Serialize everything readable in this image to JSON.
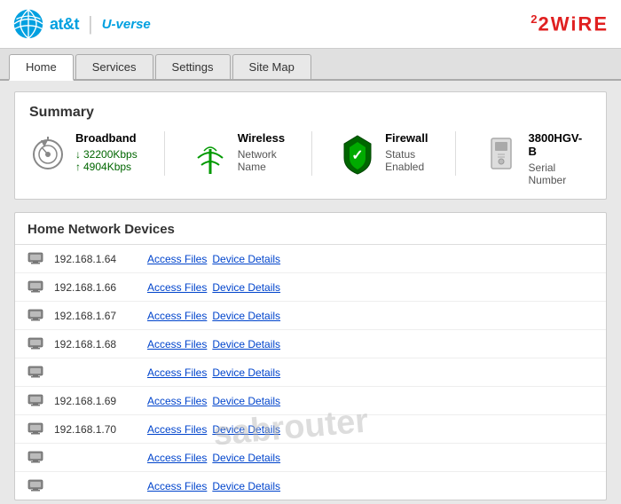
{
  "header": {
    "brand": "at&t",
    "product": "U-verse",
    "logo2wire": "2WiRE"
  },
  "nav": {
    "tabs": [
      {
        "label": "Home",
        "active": true
      },
      {
        "label": "Services",
        "active": false
      },
      {
        "label": "Settings",
        "active": false
      },
      {
        "label": "Site Map",
        "active": false
      }
    ]
  },
  "summary": {
    "title": "Summary",
    "items": [
      {
        "icon": "broadband",
        "title": "Broadband",
        "line1": "32200Kbps",
        "line2": "4904Kbps"
      },
      {
        "icon": "wireless",
        "title": "Wireless",
        "line1": "Network",
        "line2": "Name"
      },
      {
        "icon": "firewall",
        "title": "Firewall",
        "line1": "Status",
        "line2": "Enabled"
      },
      {
        "icon": "device",
        "title": "3800HGV-B",
        "line1": "Serial",
        "line2": "Number"
      }
    ]
  },
  "devices": {
    "title": "Home Network Devices",
    "rows": [
      {
        "ip": "192.168.1.64",
        "access_label": "Access Files",
        "details_label": "Device Details"
      },
      {
        "ip": "192.168.1.66",
        "access_label": "Access Files",
        "details_label": "Device Details"
      },
      {
        "ip": "192.168.1.67",
        "access_label": "Access Files",
        "details_label": "Device Details"
      },
      {
        "ip": "192.168.1.68",
        "access_label": "Access Files",
        "details_label": "Device Details"
      },
      {
        "ip": "",
        "access_label": "Access Files",
        "details_label": "Device Details"
      },
      {
        "ip": "192.168.1.69",
        "access_label": "Access Files",
        "details_label": "Device Details"
      },
      {
        "ip": "192.168.1.70",
        "access_label": "Access Files",
        "details_label": "Device Details"
      },
      {
        "ip": "",
        "access_label": "Access Files",
        "details_label": "Device Details"
      },
      {
        "ip": "",
        "access_label": "Access Files",
        "details_label": "Device Details"
      }
    ]
  },
  "watermark": "sabrouter"
}
